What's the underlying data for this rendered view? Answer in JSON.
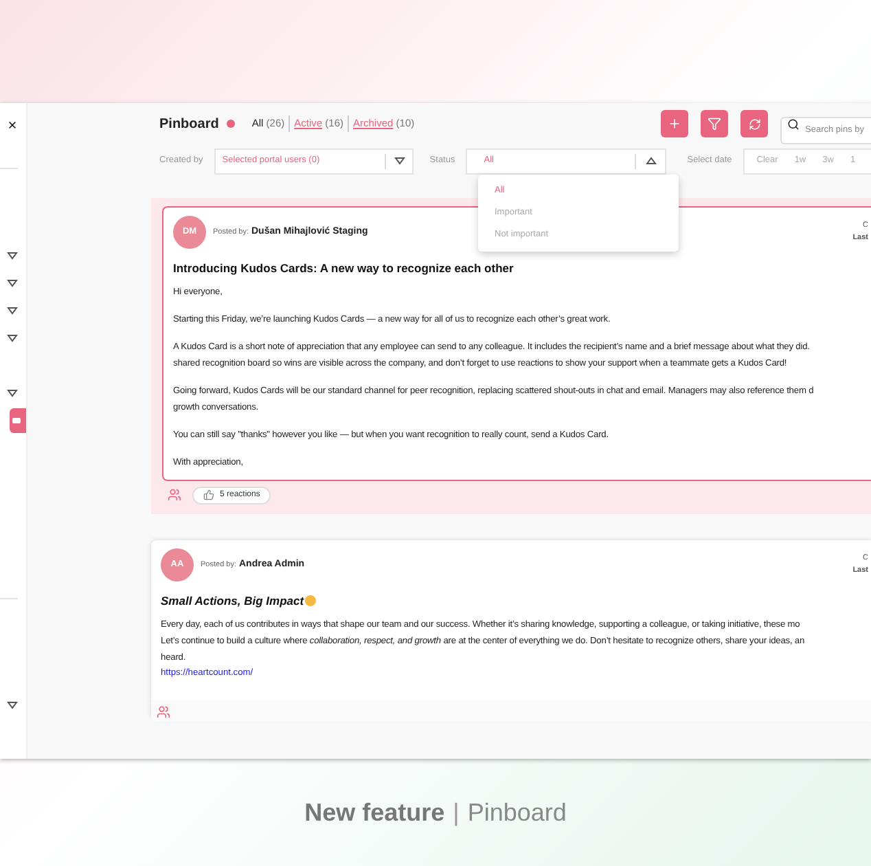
{
  "header": {
    "title": "Pinboard",
    "tabs": [
      {
        "label": "All",
        "count": "(26)",
        "selected": true
      },
      {
        "label": "Active",
        "count": "(16)",
        "selected": false
      },
      {
        "label": "Archived",
        "count": "(10)",
        "selected": false
      }
    ],
    "search": {
      "placeholder": "Search pins by"
    }
  },
  "filters": {
    "created_by": {
      "label": "Created by",
      "value": "Selected portal users (0)"
    },
    "status": {
      "label": "Status",
      "value": "All",
      "open": true,
      "options": [
        {
          "label": "All",
          "selected": true
        },
        {
          "label": "Important",
          "selected": false
        },
        {
          "label": "Not important",
          "selected": false
        }
      ]
    },
    "date": {
      "label": "Select date",
      "ranges": [
        "Clear",
        "1w",
        "3w",
        "1"
      ]
    }
  },
  "pins": [
    {
      "highlighted": true,
      "initials": "DM",
      "posted_by_label": "Posted by:",
      "author": "Dušan Mihajlović Staging",
      "meta_line_1": "C",
      "meta_line_2": "Last",
      "title": "Introducing Kudos Cards: A new way to recognize each other",
      "title_italic": false,
      "title_emoji": false,
      "paragraphs": [
        [
          "Hi everyone,"
        ],
        [
          "Starting this Friday, we’re launching Kudos Cards — a new way for all of us to recognize each other’s great work."
        ],
        [
          "A Kudos Card is a short note of appreciation that any employee can send to any colleague. It includes the recipient’s name and a brief message about what they did.",
          "shared recognition board so wins are visible across the company, and don’t forget to use reactions to show your support when a teammate gets a Kudos Card!"
        ],
        [
          "Going forward, Kudos Cards will be our standard channel for peer recognition, replacing scattered shout-outs in chat and email. Managers may also reference them d",
          "growth conversations."
        ],
        [
          "You can still say \"thanks\" however you like — but when you want recognition to really count, send a Kudos Card."
        ],
        [
          "With appreciation,"
        ]
      ],
      "reactions": "5 reactions"
    },
    {
      "highlighted": false,
      "initials": "AA",
      "posted_by_label": "Posted by:",
      "author": "Andrea Admin",
      "meta_line_1": "C",
      "meta_line_2": "Last",
      "title": "Small Actions, Big Impact",
      "title_italic": true,
      "title_emoji": true,
      "paragraphs": [
        [
          "Every day, each of us contributes in ways that shape our team and our success. Whether it’s sharing knowledge, supporting a colleague, or taking initiative, these mo",
          "Let’s continue to build a culture where *collaboration, respect, and growth* are at the center of everything we do. Don’t hesitate to recognize others, share your ideas, an",
          "heard."
        ]
      ],
      "link": "https://heartcount.com/"
    }
  ],
  "caption": {
    "bold": "New feature",
    "separator": "|",
    "rest": "Pinboard"
  }
}
